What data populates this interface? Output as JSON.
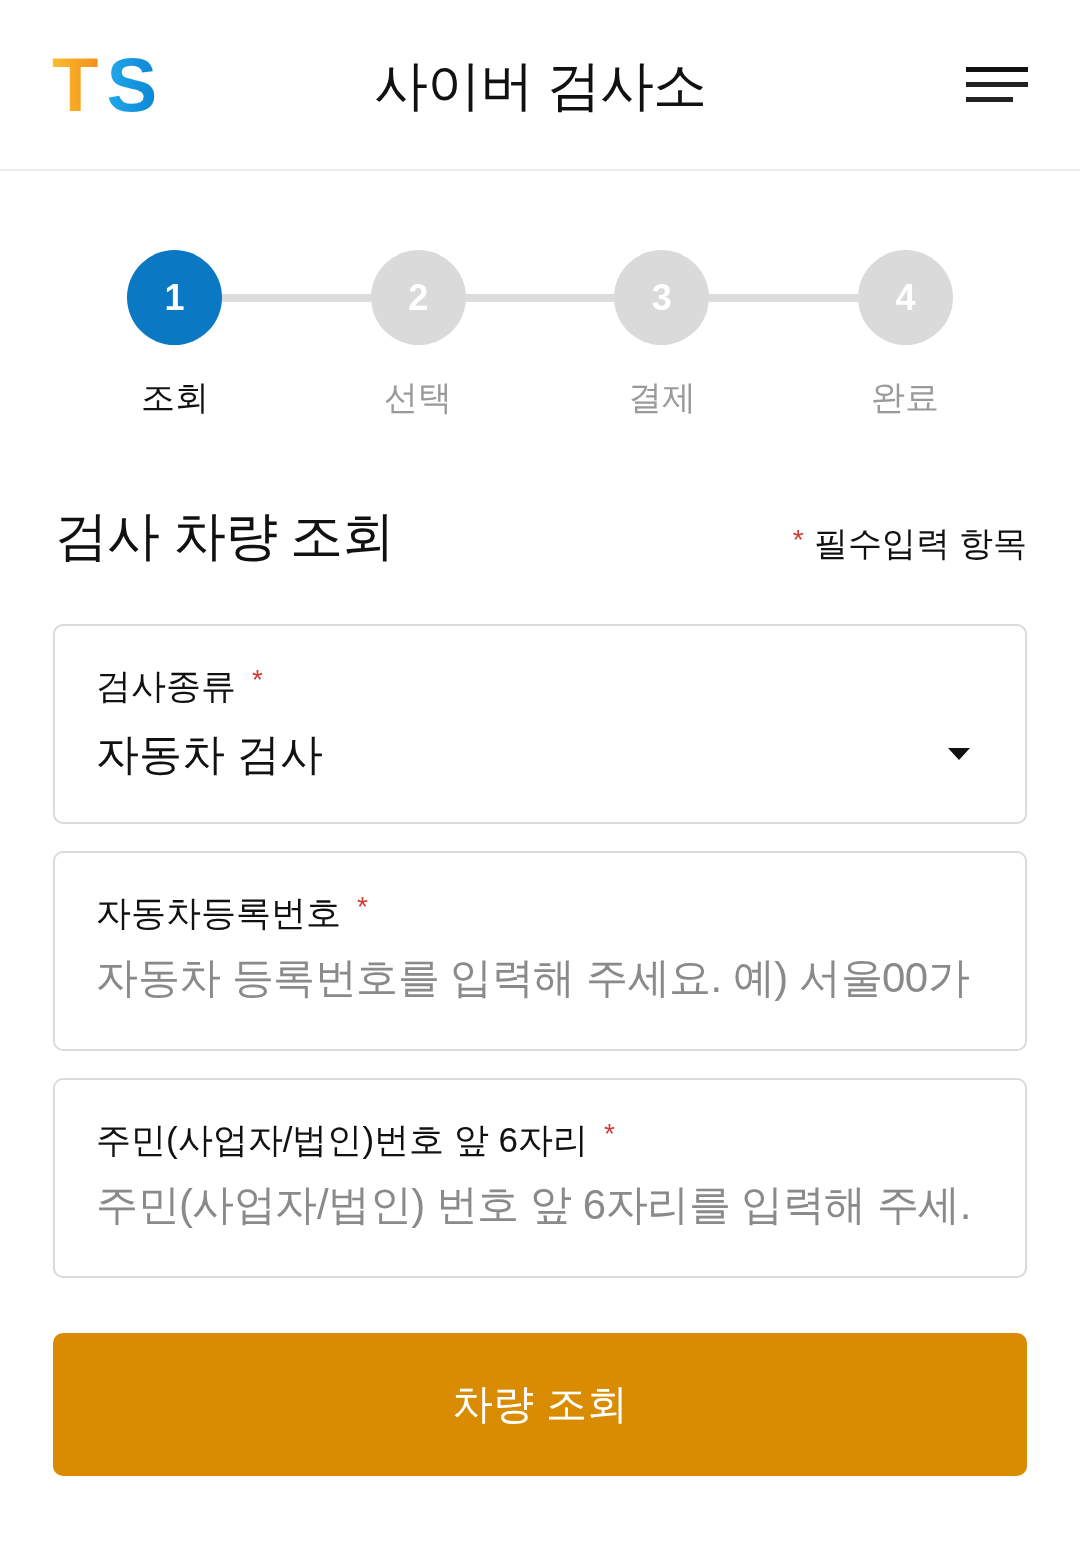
{
  "header": {
    "logo": "TS",
    "title": "사이버 검사소"
  },
  "steps": [
    {
      "number": "1",
      "label": "조회",
      "selected": true
    },
    {
      "number": "2",
      "label": "선택",
      "selected": false
    },
    {
      "number": "3",
      "label": "결제",
      "selected": false
    },
    {
      "number": "4",
      "label": "완료",
      "selected": false
    }
  ],
  "section": {
    "title": "검사 차량 조회",
    "legend": {
      "mark": "*",
      "text": "필수입력 항목"
    }
  },
  "fields": [
    {
      "kind": "select",
      "label": "검사종류",
      "required_mark": "*",
      "value": "자동차 검사"
    },
    {
      "kind": "text",
      "label": "자동차등록번호",
      "required_mark": "*",
      "placeholder": "자동차 등록번호를 입력해 주세요. 예) 서울00가"
    },
    {
      "kind": "text",
      "label": "주민(사업자/법인)번호 앞 6자리",
      "required_mark": "*",
      "placeholder": "주민(사업자/법인) 번호 앞 6자리를 입력해 주세."
    }
  ],
  "submit_button": "차량 조회"
}
